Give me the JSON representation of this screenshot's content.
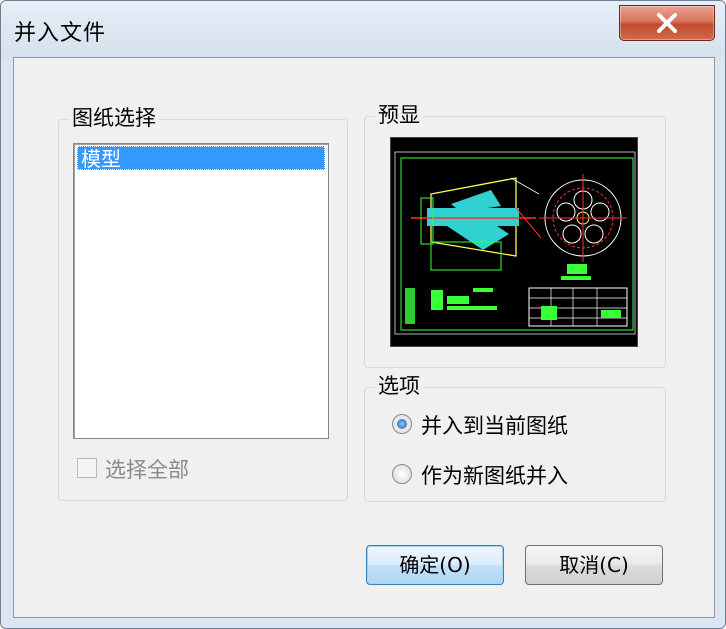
{
  "window": {
    "title": "并入文件"
  },
  "sheet_group": {
    "title": "图纸选择",
    "items": [
      "模型"
    ],
    "select_all_label": "选择全部"
  },
  "preview_group": {
    "title": "预显"
  },
  "options_group": {
    "title": "选项",
    "radio_merge_current": "并入到当前图纸",
    "radio_merge_new": "作为新图纸并入",
    "selected": "并入到当前图纸"
  },
  "buttons": {
    "ok": "确定(O)",
    "cancel": "取消(C)"
  },
  "colors": {
    "selection": "#3399ff",
    "close_button": "#c7503a",
    "preview_background": "#000000"
  }
}
